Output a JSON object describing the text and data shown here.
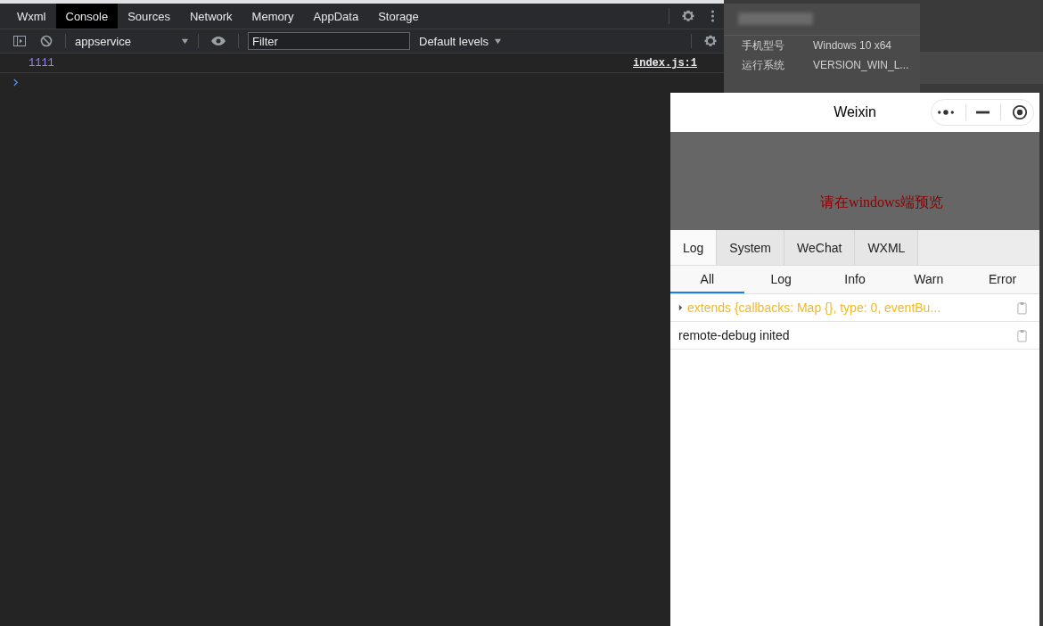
{
  "devtools": {
    "tabs": [
      {
        "label": "Wxml",
        "selected": false
      },
      {
        "label": "Console",
        "selected": true
      },
      {
        "label": "Sources",
        "selected": false
      },
      {
        "label": "Network",
        "selected": false
      },
      {
        "label": "Memory",
        "selected": false
      },
      {
        "label": "AppData",
        "selected": false
      },
      {
        "label": "Storage",
        "selected": false
      }
    ],
    "toolbar": {
      "context": "appservice",
      "filter": {
        "placeholder": "Filter"
      },
      "levels": "Default levels"
    },
    "console": {
      "messages": [
        {
          "text": "1111",
          "source": "index.js:1"
        }
      ]
    }
  },
  "info_panel": {
    "rows": [
      {
        "label": "手机型号",
        "value": "Windows 10 x64"
      },
      {
        "label": "运行系统",
        "value": "VERSION_WIN_L..."
      }
    ]
  },
  "simulator": {
    "title": "Weixin",
    "preview_text": "请在windows端预览",
    "tabs": [
      {
        "label": "Log",
        "selected": true
      },
      {
        "label": "System",
        "selected": false
      },
      {
        "label": "WeChat",
        "selected": false
      },
      {
        "label": "WXML",
        "selected": false
      }
    ],
    "filters": [
      {
        "label": "All",
        "selected": true
      },
      {
        "label": "Log",
        "selected": false
      },
      {
        "label": "Info",
        "selected": false
      },
      {
        "label": "Warn",
        "selected": false
      },
      {
        "label": "Error",
        "selected": false
      }
    ],
    "logs": [
      {
        "kind": "object",
        "text": "extends {callbacks: Map {}, type: 0, eventBu..."
      },
      {
        "kind": "text",
        "text": "remote-debug inited"
      }
    ]
  }
}
